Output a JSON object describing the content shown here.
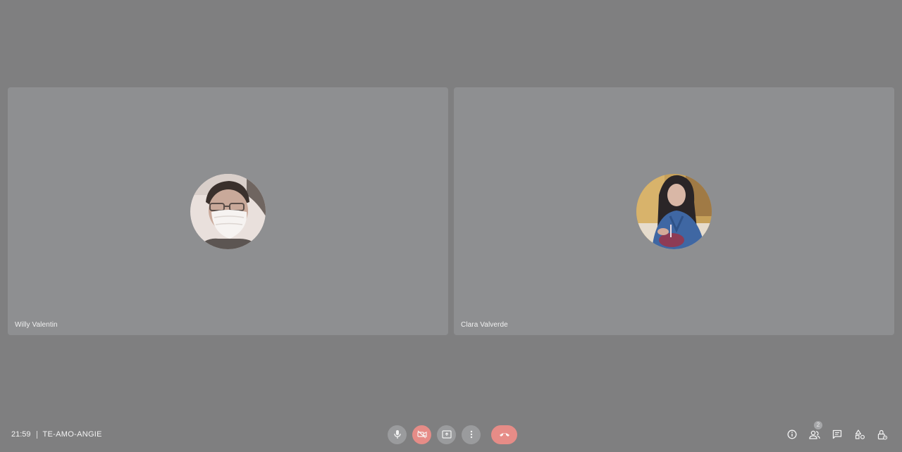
{
  "participants": [
    {
      "name": "Willy Valentin"
    },
    {
      "name": "Clara Valverde"
    }
  ],
  "meeting": {
    "time": "21:59",
    "code": "TE-AMO-ANGIE"
  },
  "controls": {
    "microphone": "microphone-icon",
    "camera_off": "camera-off-icon",
    "present": "present-screen-icon",
    "more": "more-options-icon",
    "hangup": "hang-up-icon"
  },
  "toolbar_right": {
    "people_count": "2"
  },
  "colors": {
    "background": "#7f7f80",
    "tile": "#8e8f91",
    "danger": "#e68c87"
  }
}
